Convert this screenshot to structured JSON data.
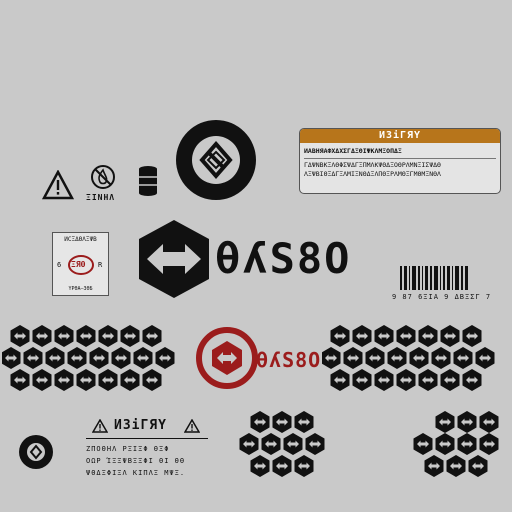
{
  "brand": {
    "wordmark": "θʎS8O",
    "colors": {
      "black": "#111111",
      "red": "#9b1c1c",
      "amber": "#b7751b"
    }
  },
  "warning_label": {
    "title": "ИЗіΓЯΥ",
    "line1": "ИАВНЯАФХΔΧΣΓΔΞΘΙΨΚΛΜΞΟΠΔΞ",
    "line2": "ΓΔΨΝΒΚΞΛΘΦΣΨΔΓΞΠΜΛΚΨΘΔΞΟΘΡΛΜΝΞΙΣΨΔΘ",
    "line3": "ΛΞΨΒΙΘΞΔΓΞΛΜΙΞΝΘΔΞΛΠΘΞΡΛΜΘΞΓΜΘΜΞΝΘΛ"
  },
  "icon_caption": "ΞΙΝΗΛ",
  "cert_label": {
    "title": "ИСΞΔΘΛΞΨΒ",
    "badge": "ΞЯΘ",
    "left_mark": "6",
    "right_mark": "R",
    "footer": "ΥΡΘΑ—ЗΘБ"
  },
  "barcode_caption": "9  87 6ΞΙΑ 9 ΔΒΞΣΓ 7",
  "notice_block": {
    "title": "ИЗіΓЯΥ",
    "line1": "ΖΠΟΘΗΛ ΡΞΙΞΦ ΘΞΦ",
    "line2": "ΟΩΡ ΊΞΞΨΒΞΞΦΙ ΘΙ ΘΘ",
    "line3": "ΨΘΔΞΦΙΞΛ ΚΙΠΛΞ ΜΨΞ."
  },
  "icons": [
    "warning-triangle-icon",
    "no-fire-icon",
    "barrel-icon",
    "brand-roundel-icon"
  ]
}
